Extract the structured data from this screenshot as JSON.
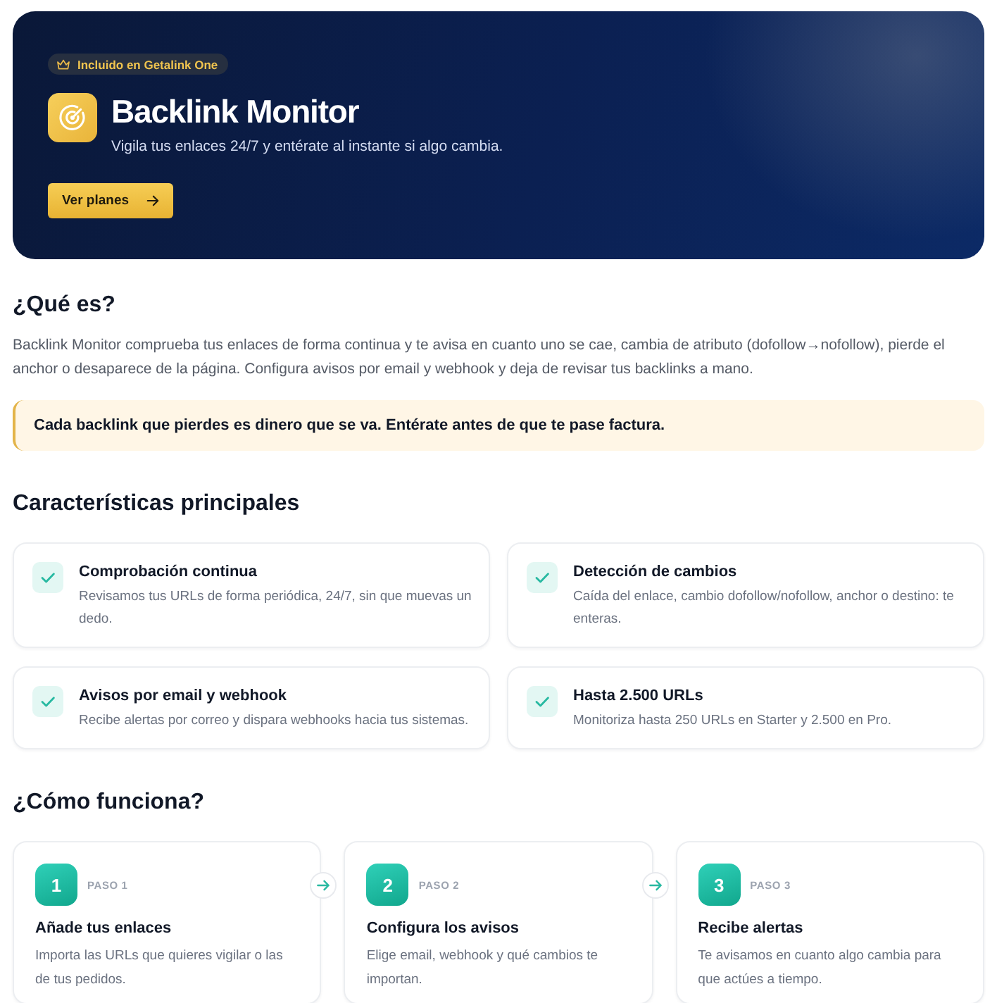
{
  "hero": {
    "badge": "Incluido en Getalink One",
    "title": "Backlink Monitor",
    "subtitle": "Vigila tus enlaces 24/7 y entérate al instante si algo cambia.",
    "button": "Ver planes"
  },
  "about": {
    "heading": "¿Qué es?",
    "text": "Backlink Monitor comprueba tus enlaces de forma continua y te avisa en cuanto uno se cae, cambia de atributo (dofollow→nofollow), pierde el anchor o desaparece de la página. Configura avisos por email y webhook y deja de revisar tus backlinks a mano.",
    "callout": "Cada backlink que pierdes es dinero que se va. Entérate antes de que te pase factura."
  },
  "features": {
    "heading": "Características principales",
    "items": [
      {
        "title": "Comprobación continua",
        "description": "Revisamos tus URLs de forma periódica, 24/7, sin que muevas un dedo."
      },
      {
        "title": "Detección de cambios",
        "description": "Caída del enlace, cambio dofollow/nofollow, anchor o destino: te enteras."
      },
      {
        "title": "Avisos por email y webhook",
        "description": "Recibe alertas por correo y dispara webhooks hacia tus sistemas."
      },
      {
        "title": "Hasta 2.500 URLs",
        "description": "Monitoriza hasta 250 URLs en Starter y 2.500 en Pro."
      }
    ]
  },
  "steps": {
    "heading": "¿Cómo funciona?",
    "items": [
      {
        "number": "1",
        "label": "PASO 1",
        "title": "Añade tus enlaces",
        "description": "Importa las URLs que quieres vigilar o las de tus pedidos."
      },
      {
        "number": "2",
        "label": "PASO 2",
        "title": "Configura los avisos",
        "description": "Elige email, webhook y qué cambios te importan."
      },
      {
        "number": "3",
        "label": "PASO 3",
        "title": "Recibe alertas",
        "description": "Te avisamos en cuanto algo cambia para que actúes a tiempo."
      }
    ]
  }
}
